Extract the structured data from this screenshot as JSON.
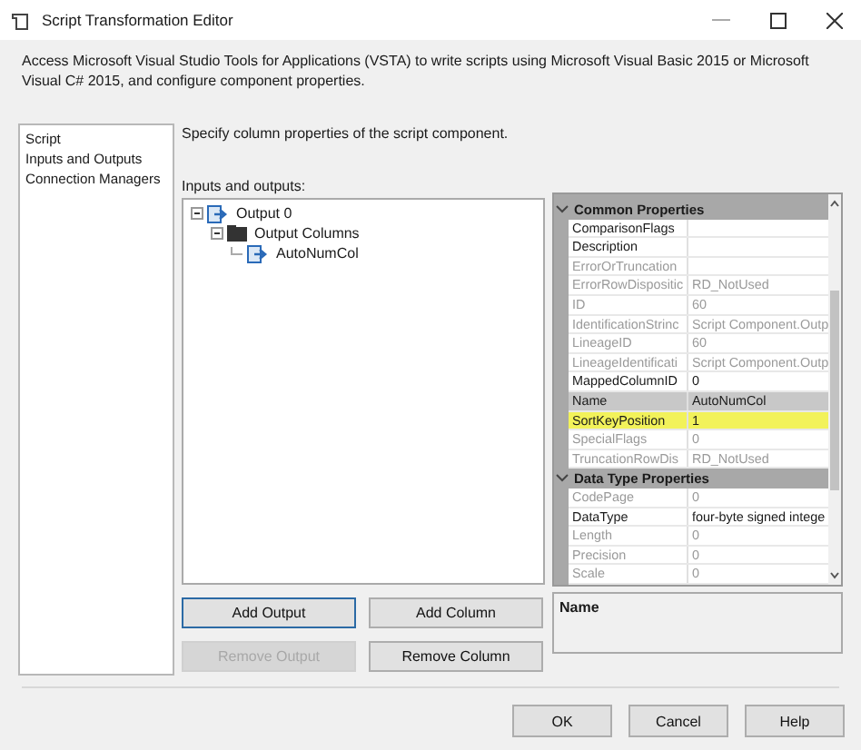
{
  "window": {
    "title": "Script Transformation Editor"
  },
  "description": "Access Microsoft Visual Studio Tools for Applications (VSTA) to write scripts using Microsoft Visual Basic 2015 or Microsoft Visual C# 2015, and configure component properties.",
  "nav": [
    {
      "label": "Script",
      "selected": false
    },
    {
      "label": "Inputs and Outputs",
      "selected": false
    },
    {
      "label": "Connection Managers",
      "selected": false
    }
  ],
  "page_caption": "Specify column properties of the script component.",
  "tree_label": "Inputs and outputs:",
  "tree": [
    {
      "label": "Output 0",
      "kind": "output",
      "expanded": true,
      "children": [
        {
          "label": "Output Columns",
          "kind": "folder",
          "expanded": true,
          "children": [
            {
              "label": "AutoNumCol",
              "kind": "column"
            }
          ]
        }
      ]
    }
  ],
  "tree_buttons": [
    {
      "label": "Add Output",
      "disabled": false,
      "focused": true
    },
    {
      "label": "Add Column",
      "disabled": false,
      "focused": false
    },
    {
      "label": "Remove Output",
      "disabled": true,
      "focused": false
    },
    {
      "label": "Remove Column",
      "disabled": false,
      "focused": false
    }
  ],
  "properties": [
    {
      "category": "Common Properties",
      "expanded": true,
      "rows": [
        {
          "name": "ComparisonFlags",
          "value": "",
          "disabled": false,
          "selected": false,
          "highlighted": false
        },
        {
          "name": "Description",
          "value": "",
          "disabled": false,
          "selected": false,
          "highlighted": false
        },
        {
          "name": "ErrorOrTruncation",
          "value": "",
          "disabled": true,
          "selected": false,
          "highlighted": false
        },
        {
          "name": "ErrorRowDispositic",
          "value": "RD_NotUsed",
          "disabled": true,
          "selected": false,
          "highlighted": false
        },
        {
          "name": "ID",
          "value": "60",
          "disabled": true,
          "selected": false,
          "highlighted": false
        },
        {
          "name": "IdentificationStrinc",
          "value": "Script Component.Outp",
          "disabled": true,
          "selected": false,
          "highlighted": false
        },
        {
          "name": "LineageID",
          "value": "60",
          "disabled": true,
          "selected": false,
          "highlighted": false
        },
        {
          "name": "LineageIdentificati",
          "value": "Script Component.Outp",
          "disabled": true,
          "selected": false,
          "highlighted": false
        },
        {
          "name": "MappedColumnID",
          "value": "0",
          "disabled": false,
          "selected": false,
          "highlighted": false
        },
        {
          "name": "Name",
          "value": "AutoNumCol",
          "disabled": false,
          "selected": true,
          "highlighted": false
        },
        {
          "name": "SortKeyPosition",
          "value": "1",
          "disabled": false,
          "selected": false,
          "highlighted": true
        },
        {
          "name": "SpecialFlags",
          "value": "0",
          "disabled": true,
          "selected": false,
          "highlighted": false
        },
        {
          "name": "TruncationRowDis",
          "value": "RD_NotUsed",
          "disabled": true,
          "selected": false,
          "highlighted": false
        }
      ]
    },
    {
      "category": "Data Type Properties",
      "expanded": true,
      "rows": [
        {
          "name": "CodePage",
          "value": "0",
          "disabled": true,
          "selected": false,
          "highlighted": false
        },
        {
          "name": "DataType",
          "value": "four-byte signed intege",
          "disabled": false,
          "selected": false,
          "highlighted": false
        },
        {
          "name": "Length",
          "value": "0",
          "disabled": true,
          "selected": false,
          "highlighted": false
        },
        {
          "name": "Precision",
          "value": "0",
          "disabled": true,
          "selected": false,
          "highlighted": false
        },
        {
          "name": "Scale",
          "value": "0",
          "disabled": true,
          "selected": false,
          "highlighted": false
        }
      ]
    }
  ],
  "property_help": {
    "title": "Name"
  },
  "buttons": [
    "OK",
    "Cancel",
    "Help"
  ]
}
